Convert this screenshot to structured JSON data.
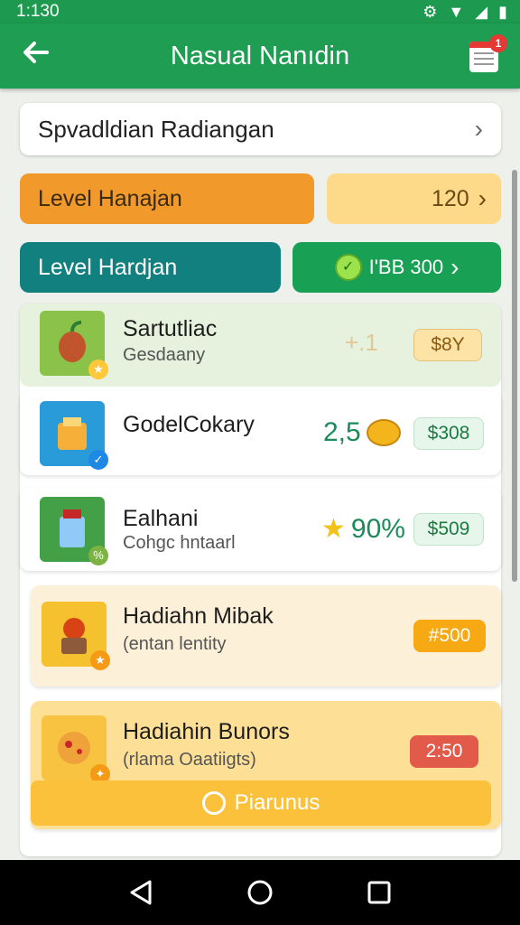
{
  "status": {
    "time": "1:130"
  },
  "appbar": {
    "title": "Nasual Nanıdin",
    "notif_count": "1"
  },
  "search_card": {
    "label": "Spvadldian Radiangan"
  },
  "level_row_1": {
    "label": "Level Hanajan",
    "value": "120"
  },
  "level_row_2": {
    "label": "Level Hardjan",
    "value": "I'BB 300"
  },
  "items": [
    {
      "title": "Sartutliac",
      "subtitle": "Gesdaany",
      "stat": "+.1",
      "price": "$8Y"
    },
    {
      "title": "GodelCokary",
      "subtitle": "",
      "stat": "2,5",
      "price": "$308"
    },
    {
      "title": "Ealhani",
      "subtitle": "Cohgc hntaarl",
      "stat": "90%",
      "price": "$509"
    },
    {
      "title": "Hadiahn Mibak",
      "subtitle": "(entan lentity",
      "stat": "",
      "price": "#500"
    },
    {
      "title": "Hadiahin Bunors",
      "subtitle": "(rlama Oaatiigts)",
      "stat": "",
      "price": "2:50"
    }
  ],
  "premium_button": {
    "label": "Piarunus"
  },
  "colors": {
    "appbar": "#1f9d52",
    "orange": "#f19a2b",
    "teal": "#12807f",
    "green": "#18a055"
  }
}
